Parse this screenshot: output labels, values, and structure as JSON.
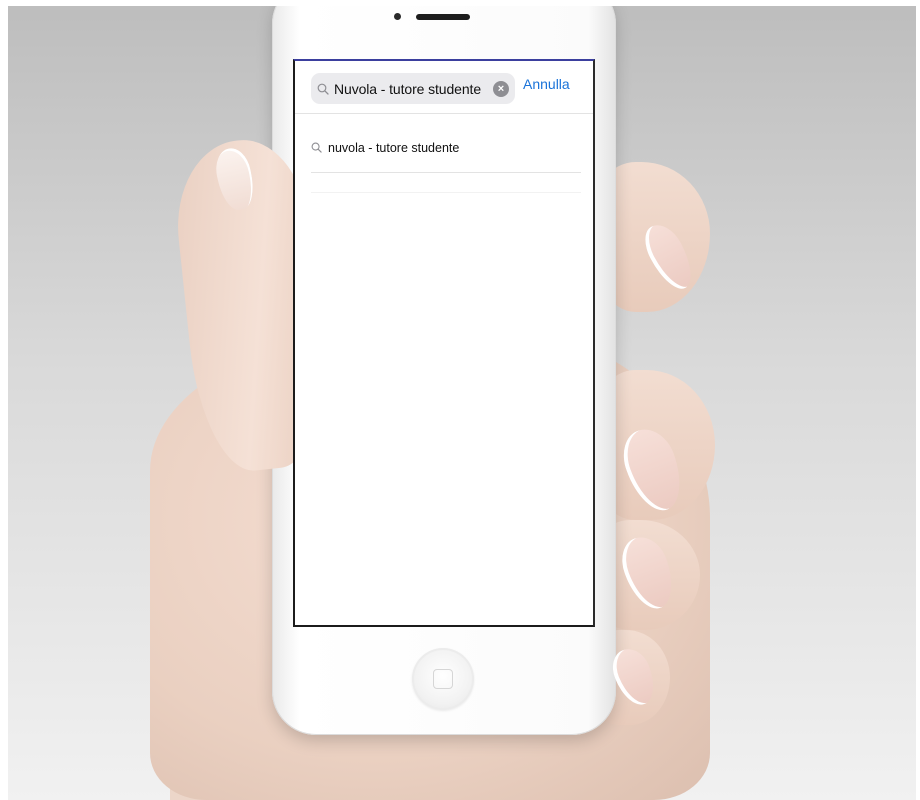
{
  "search": {
    "query": "Nuvola - tutore studente",
    "cancel_label": "Annulla",
    "icon": "search-icon",
    "clear_icon": "clear-icon"
  },
  "suggestions": [
    {
      "text": "nuvola - tutore studente",
      "icon": "search-icon"
    }
  ],
  "colors": {
    "accent": "#1a73d9",
    "search_field_bg": "#ebebee",
    "separator": "#e3e3e3"
  }
}
